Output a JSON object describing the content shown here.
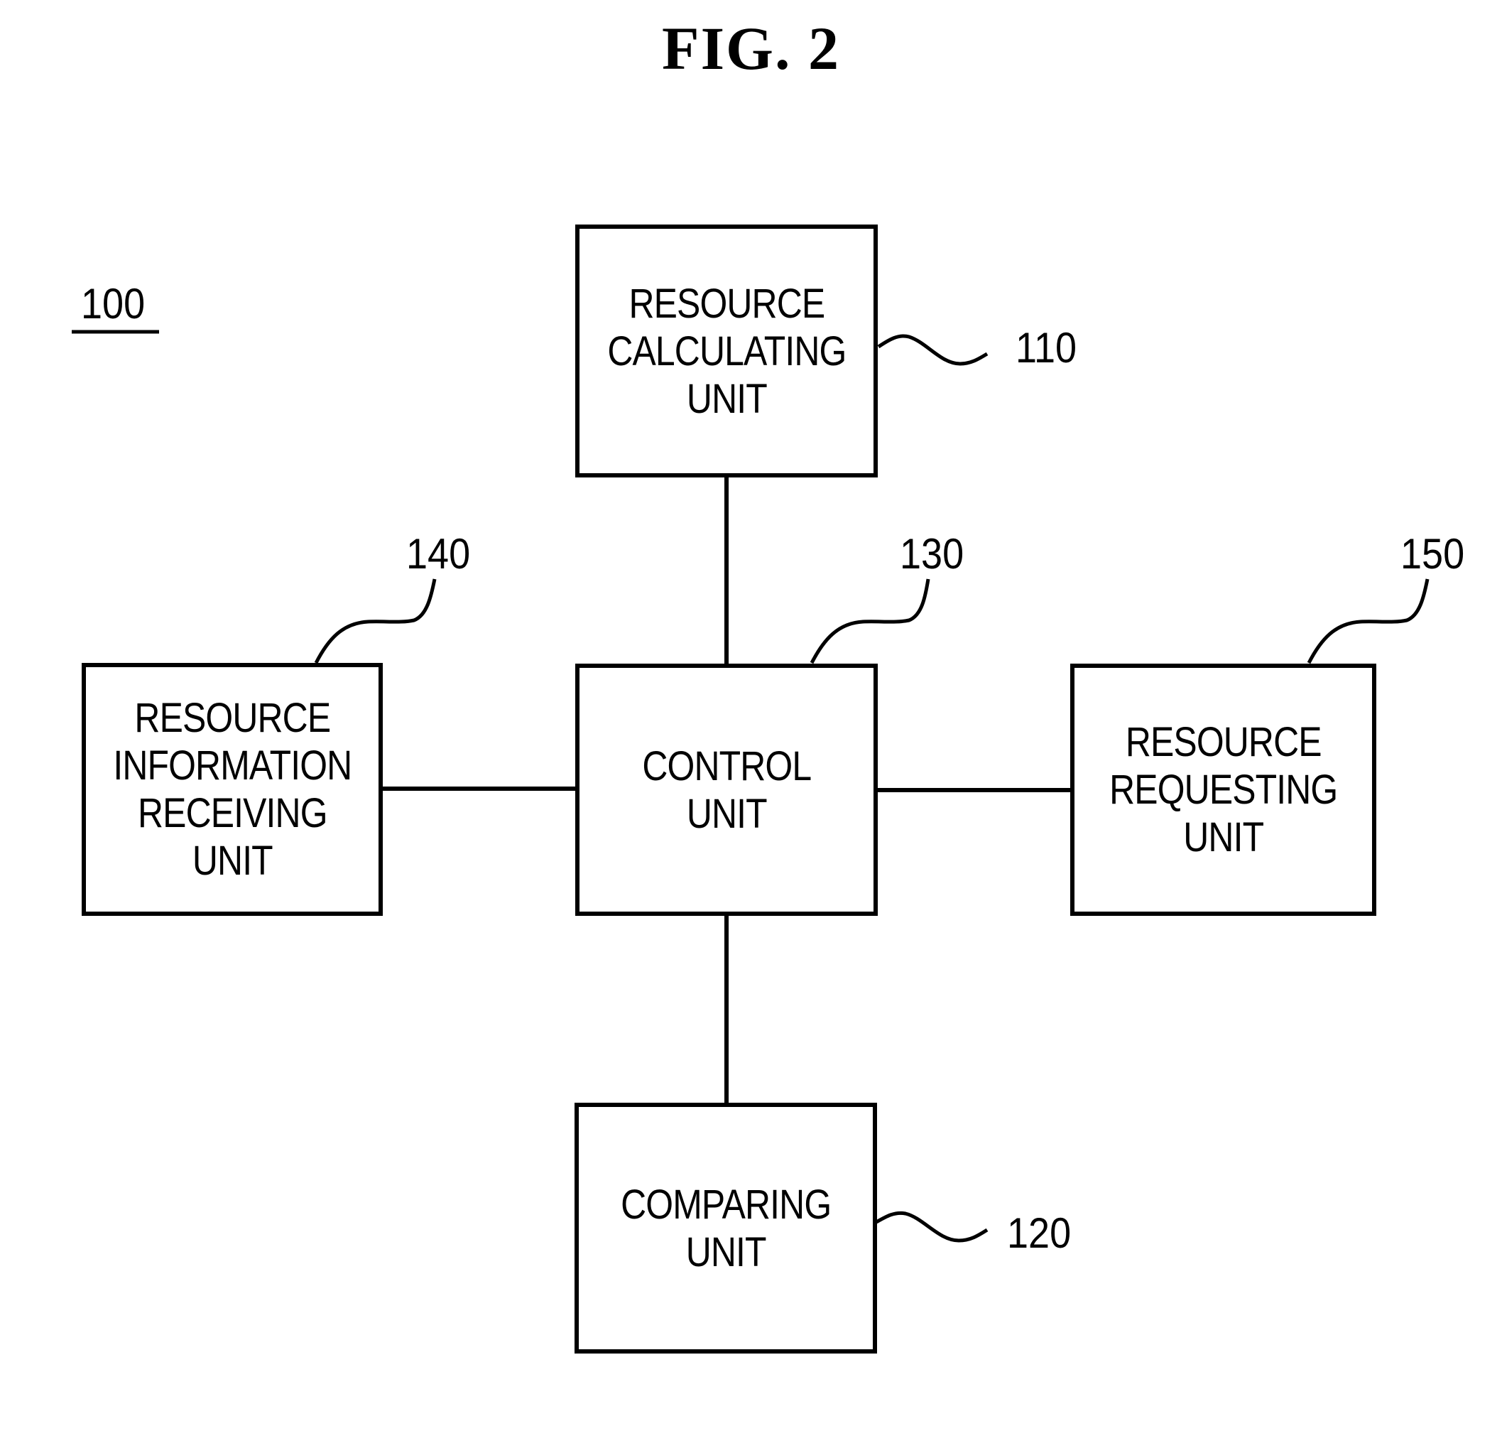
{
  "figure": {
    "title": "FIG. 2",
    "system_ref": "100"
  },
  "blocks": [
    {
      "id": "resource-calculating-unit",
      "ref": "110",
      "label": "RESOURCE\nCALCULATING\nUNIT"
    },
    {
      "id": "comparing-unit",
      "ref": "120",
      "label": "COMPARING\nUNIT"
    },
    {
      "id": "control-unit",
      "ref": "130",
      "label": "CONTROL\nUNIT"
    },
    {
      "id": "resource-information-receiving-unit",
      "ref": "140",
      "label": "RESOURCE\nINFORMATION\nRECEIVING\nUNIT"
    },
    {
      "id": "resource-requesting-unit",
      "ref": "150",
      "label": "RESOURCE\nREQUESTING\nUNIT"
    }
  ],
  "connections": [
    {
      "from": "control-unit",
      "to": "resource-calculating-unit"
    },
    {
      "from": "control-unit",
      "to": "comparing-unit"
    },
    {
      "from": "control-unit",
      "to": "resource-information-receiving-unit"
    },
    {
      "from": "control-unit",
      "to": "resource-requesting-unit"
    }
  ]
}
